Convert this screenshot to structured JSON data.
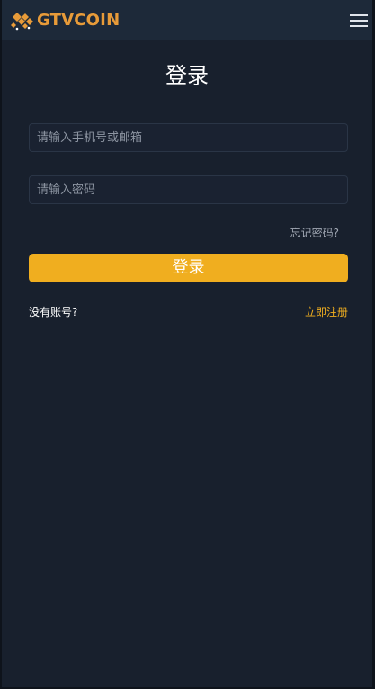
{
  "header": {
    "brand": "GTVCOIN",
    "brand_color": "#e89b39",
    "menu_icon": "hamburger-menu-icon"
  },
  "login": {
    "title": "登录",
    "username_placeholder": "请输入手机号或邮箱",
    "username_value": "",
    "password_placeholder": "请输入密码",
    "password_value": "",
    "forgot_label": "忘记密码?",
    "submit_label": "登录",
    "no_account_label": "没有账号?",
    "register_label": "立即注册"
  },
  "colors": {
    "background": "#18202d",
    "header": "#1d2939",
    "accent": "#f0ae1f"
  }
}
